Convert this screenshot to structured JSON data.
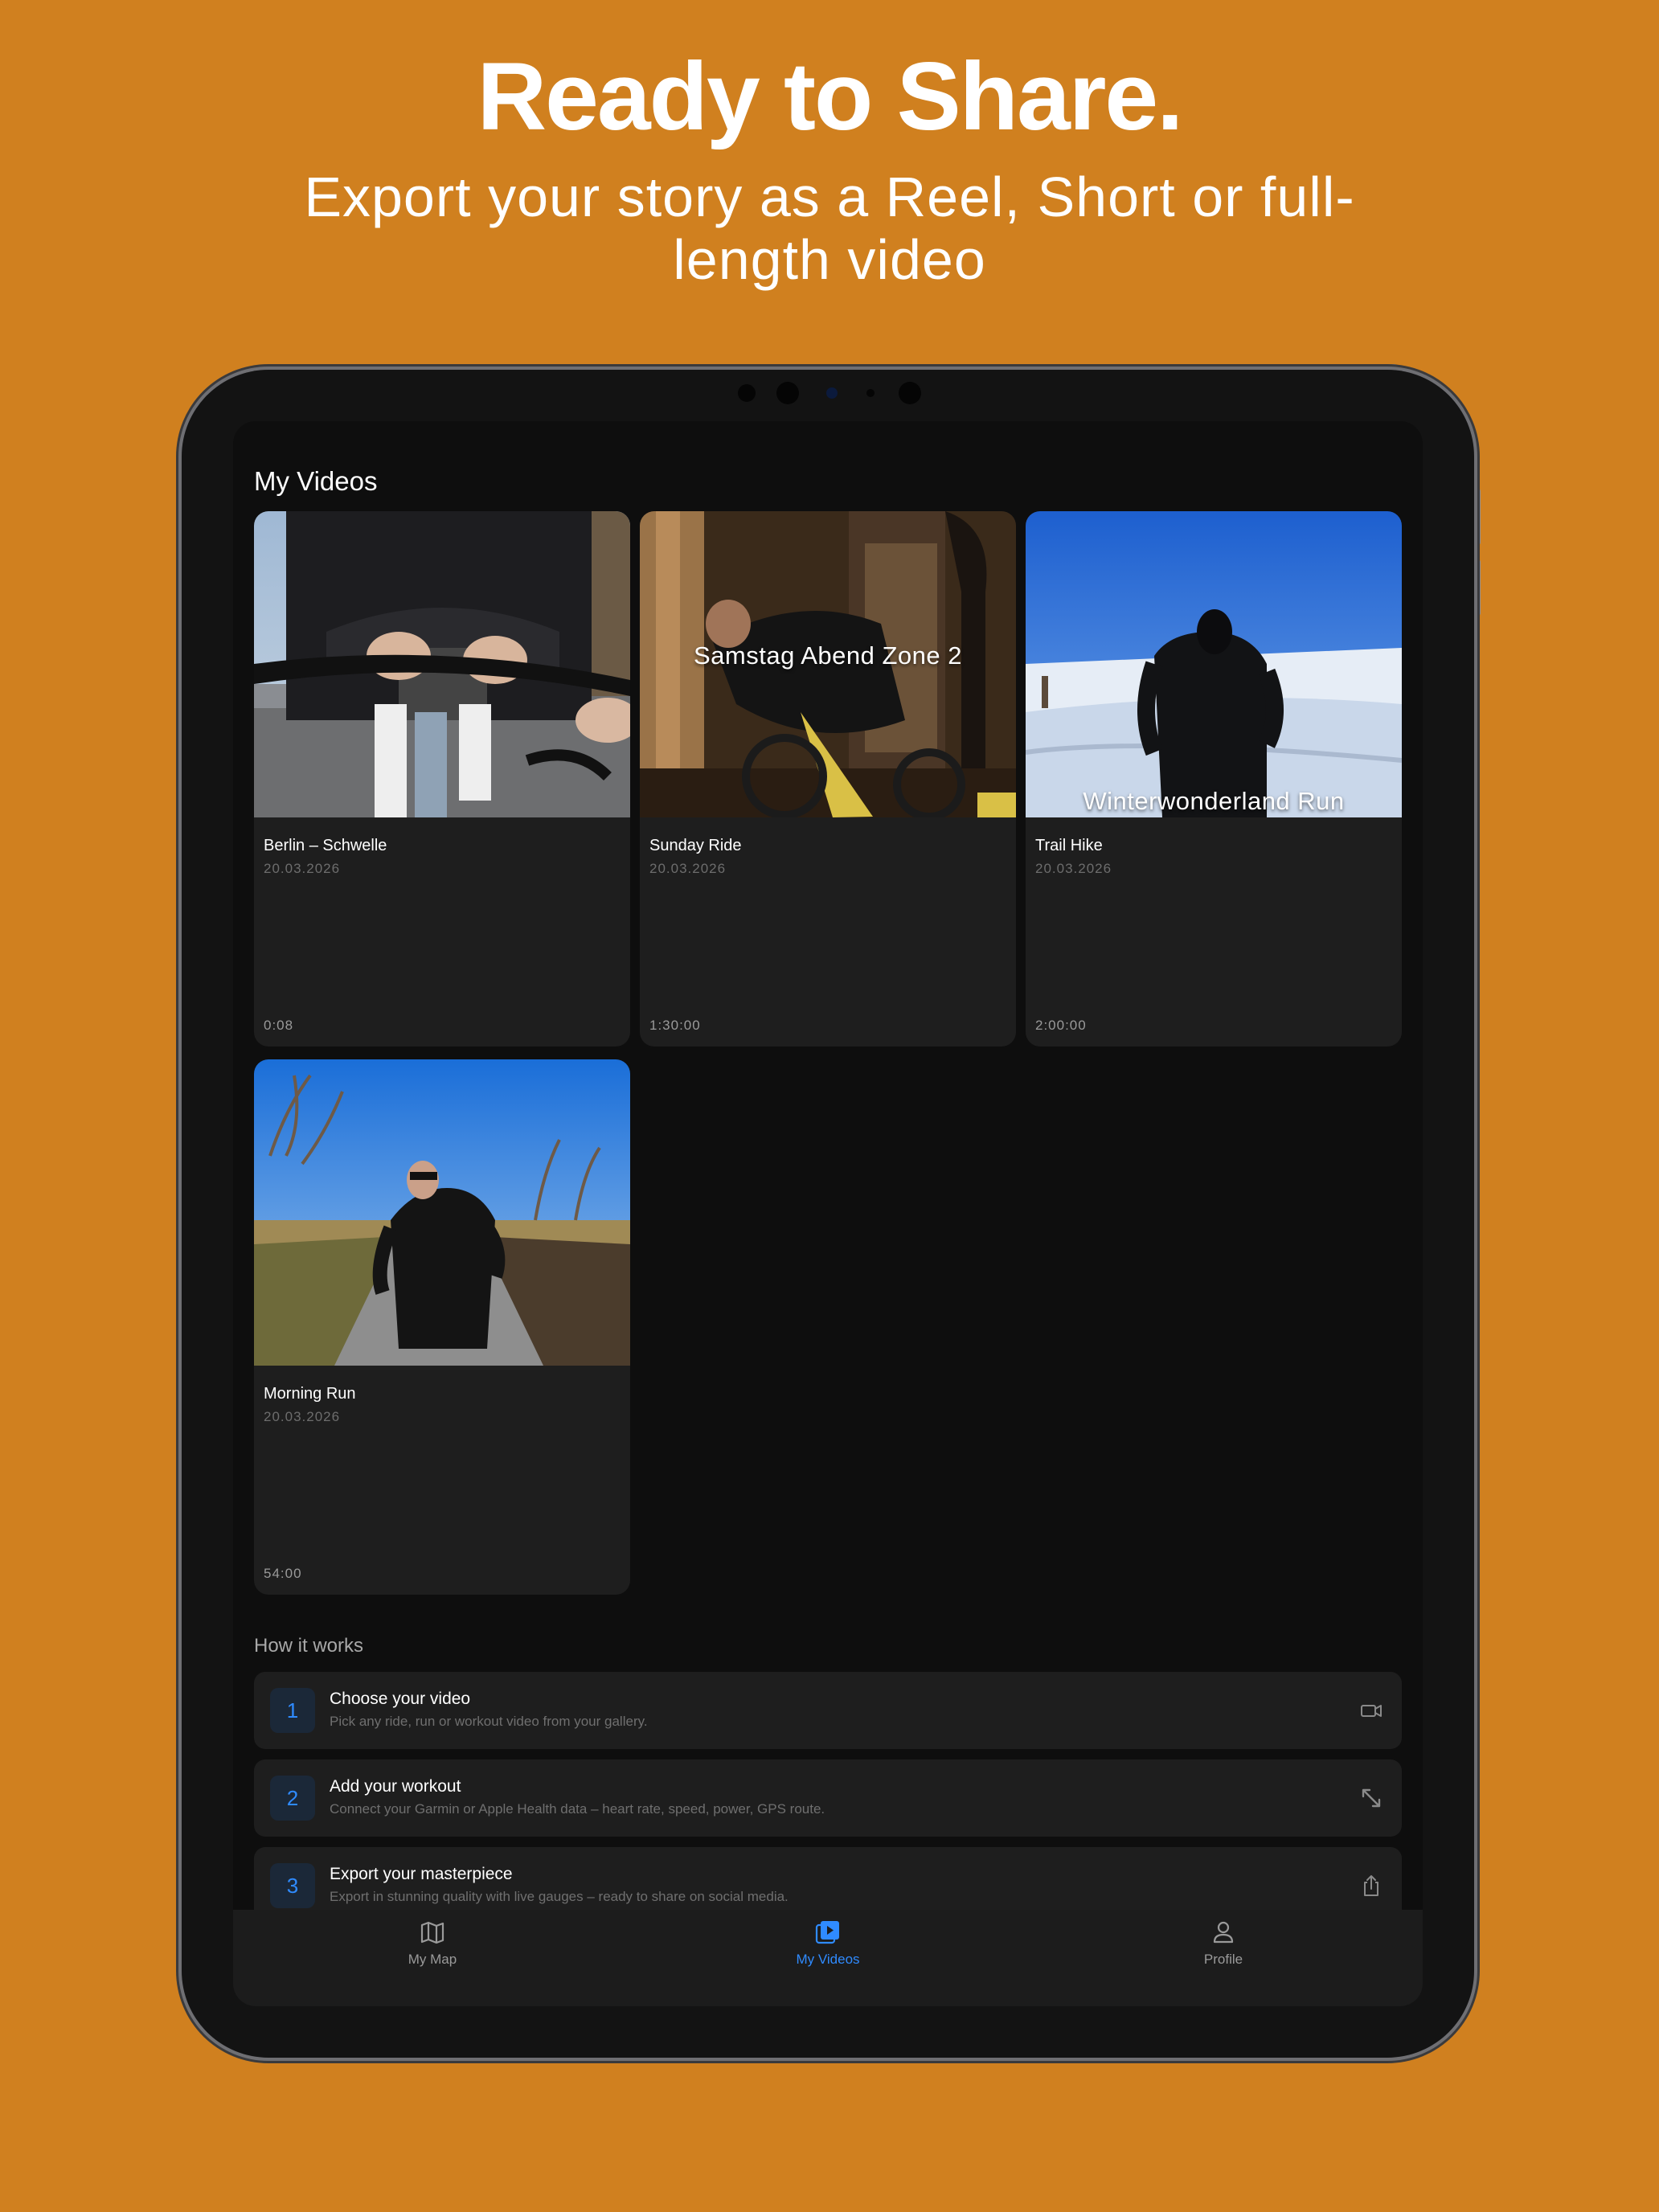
{
  "hero": {
    "title": "Ready to Share.",
    "subtitle": "Export your story as a Reel, Short or full-length video"
  },
  "my_videos": {
    "title": "My Videos",
    "videos": [
      {
        "title": "Berlin – Schwelle",
        "date": "20.03.2026",
        "duration": "0:08",
        "overlay": ""
      },
      {
        "title": "Sunday Ride",
        "date": "20.03.2026",
        "duration": "1:30:00",
        "overlay": "Samstag Abend Zone 2"
      },
      {
        "title": "Trail Hike",
        "date": "20.03.2026",
        "duration": "2:00:00",
        "overlay": "Winterwonderland Run"
      },
      {
        "title": "Morning Run",
        "date": "20.03.2026",
        "duration": "54:00",
        "overlay": ""
      }
    ]
  },
  "how_it_works": {
    "title": "How it works",
    "steps": [
      {
        "num": "1",
        "title": "Choose your video",
        "desc": "Pick any ride, run or workout video from your gallery.",
        "icon": "video-camera-icon"
      },
      {
        "num": "2",
        "title": "Add your workout",
        "desc": "Connect your Garmin or Apple Health data – heart rate, speed, power, GPS route.",
        "icon": "expand-arrows-icon"
      },
      {
        "num": "3",
        "title": "Export your masterpiece",
        "desc": "Export in stunning quality with live gauges – ready to share on social media.",
        "icon": "share-icon"
      }
    ]
  },
  "tabbar": {
    "tabs": [
      {
        "label": "My Map",
        "icon": "map-icon",
        "active": false
      },
      {
        "label": "My Videos",
        "icon": "video-library-icon",
        "active": true
      },
      {
        "label": "Profile",
        "icon": "person-icon",
        "active": false
      }
    ]
  },
  "colors": {
    "background": "#D0801F",
    "accent": "#2F8BFF",
    "screen": "#0E0E0E",
    "card": "#1E1E1E"
  }
}
